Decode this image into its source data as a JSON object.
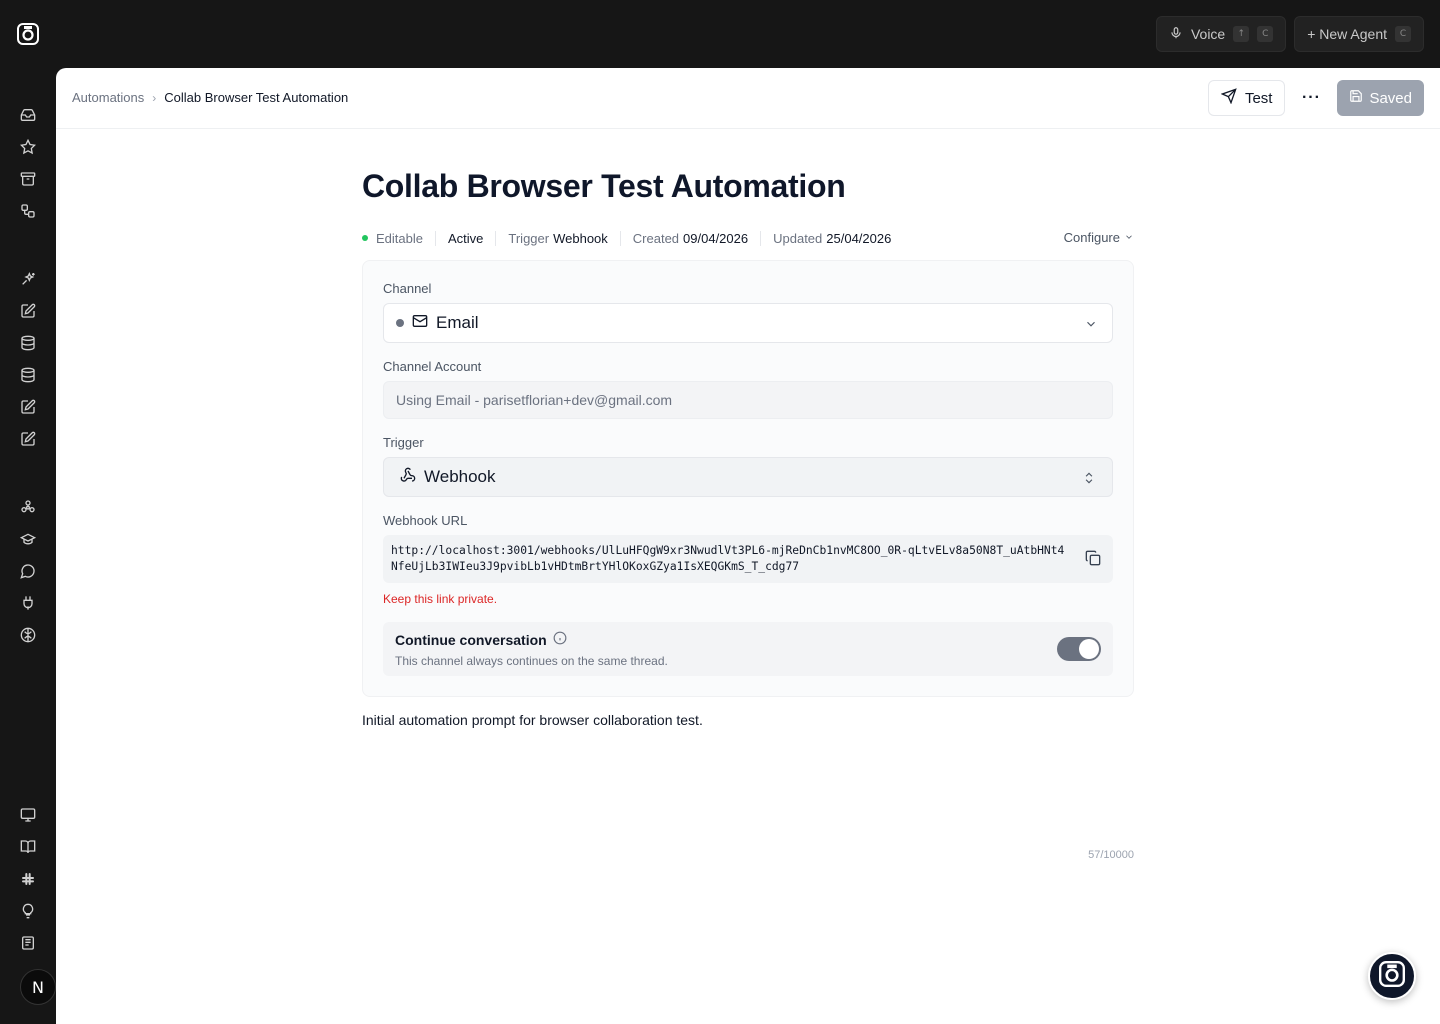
{
  "topbar": {
    "voice_label": "Voice",
    "voice_shortcut_1": "↑",
    "voice_shortcut_2": "C",
    "new_agent_label": "+ New Agent",
    "new_agent_shortcut": "C"
  },
  "sidebar": {
    "icons": [
      "inbox-icon",
      "star-icon",
      "archive-icon",
      "workflow-icon",
      "sparkles-icon",
      "edit-icon",
      "database-icon",
      "database-icon",
      "edit-icon",
      "edit-icon",
      "network-icon",
      "graduation-icon",
      "chat-icon",
      "plug-icon",
      "brain-icon",
      "monitor-icon",
      "book-icon",
      "slack-icon",
      "lightbulb-icon",
      "newspaper-icon"
    ],
    "avatar_initial": "N"
  },
  "breadcrumb": {
    "parent": "Automations",
    "separator": "›",
    "current": "Collab Browser Test Automation"
  },
  "actions": {
    "test_label": "Test",
    "more_label": "···",
    "saved_label": "Saved"
  },
  "page": {
    "title": "Collab Browser Test Automation"
  },
  "meta": {
    "editable": "Editable",
    "status": "Active",
    "trigger_label": "Trigger",
    "trigger_value": "Webhook",
    "created_label": "Created",
    "created_value": "09/04/2026",
    "updated_label": "Updated",
    "updated_value": "25/04/2026",
    "configure": "Configure"
  },
  "form": {
    "channel_label": "Channel",
    "channel_value": "Email",
    "account_label": "Channel Account",
    "account_value": "Using Email - parisetflorian+dev@gmail.com",
    "trigger_label": "Trigger",
    "trigger_value": "Webhook",
    "webhook_label": "Webhook URL",
    "webhook_url": "http://localhost:3001/webhooks/UlLuHFQgW9xr3NwudlVt3PL6-mjReDnCb1nvMC8OO_0R-qLtvELv8a50N8T_uAtbHNt4NfeUjLb3IWIeu3J9pvibLb1vHDtmBrtYHlOKoxGZya1IsXEQGKmS_T_cdg77",
    "warning": "Keep this link private.",
    "continue_title": "Continue conversation",
    "continue_desc": "This channel always continues on the same thread.",
    "continue_enabled": true
  },
  "prompt": {
    "text": "Initial automation prompt for browser collaboration test.",
    "counter": "57/10000"
  }
}
